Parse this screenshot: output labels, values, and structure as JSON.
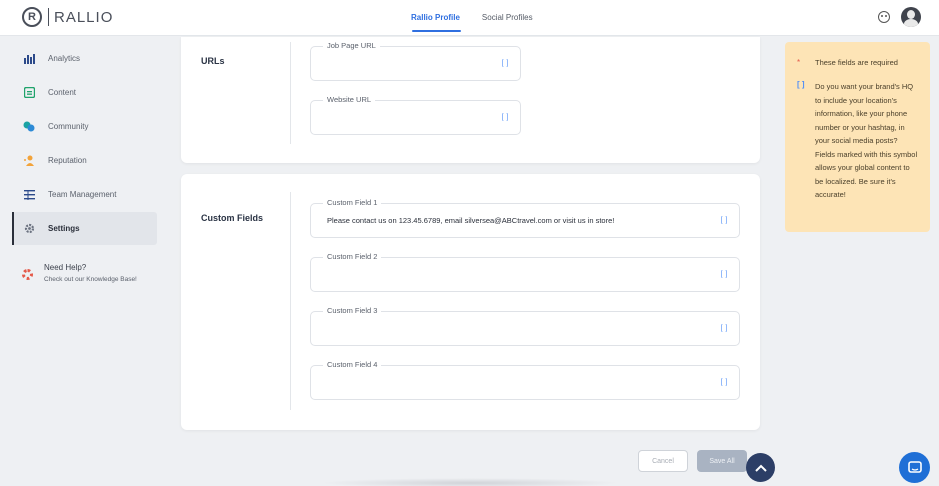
{
  "app": {
    "brand": "RALLIO"
  },
  "header": {
    "tabs": [
      {
        "label": "Rallio Profile",
        "active": true
      },
      {
        "label": "Social Profiles",
        "active": false
      }
    ]
  },
  "sidebar": {
    "items": [
      {
        "label": "Analytics",
        "icon": "analytics-icon"
      },
      {
        "label": "Content",
        "icon": "content-icon"
      },
      {
        "label": "Community",
        "icon": "community-icon"
      },
      {
        "label": "Reputation",
        "icon": "reputation-icon"
      },
      {
        "label": "Team Management",
        "icon": "team-icon"
      },
      {
        "label": "Settings",
        "icon": "gear-icon",
        "active": true
      }
    ],
    "help": {
      "title": "Need Help?",
      "subtitle": "Check out our Knowledge Base!"
    }
  },
  "urls_section": {
    "title": "URLs",
    "fields": [
      {
        "label": "Job Page URL",
        "value": "",
        "mark": "[ ]"
      },
      {
        "label": "Website URL",
        "value": "",
        "mark": "[ ]"
      }
    ]
  },
  "custom_section": {
    "title": "Custom Fields",
    "fields": [
      {
        "label": "Custom Field 1",
        "value": "Please contact us on 123.45.6789, email silversea@ABCtravel.com or visit us in store!",
        "mark": "[ ]"
      },
      {
        "label": "Custom Field 2",
        "value": "",
        "mark": "[ ]"
      },
      {
        "label": "Custom Field 3",
        "value": "",
        "mark": "[ ]"
      },
      {
        "label": "Custom Field 4",
        "value": "",
        "mark": "[ ]"
      }
    ]
  },
  "info_panel": {
    "required_symbol": "*",
    "required_text": "These fields are required",
    "localize_symbol": "[ ]",
    "localize_text": "Do you want your brand's HQ to include your location's information, like your phone number or your hashtag, in your social media posts? Fields marked with this symbol allows your global content to be localized. Be sure it's accurate!"
  },
  "footer": {
    "cancel_label": "Cancel",
    "save_label": "Save All"
  },
  "colors": {
    "accent": "#2f6fe0",
    "info_bg": "#fde4b6",
    "required": "#e45a4a",
    "localize_mark": "#4f8ef7"
  }
}
